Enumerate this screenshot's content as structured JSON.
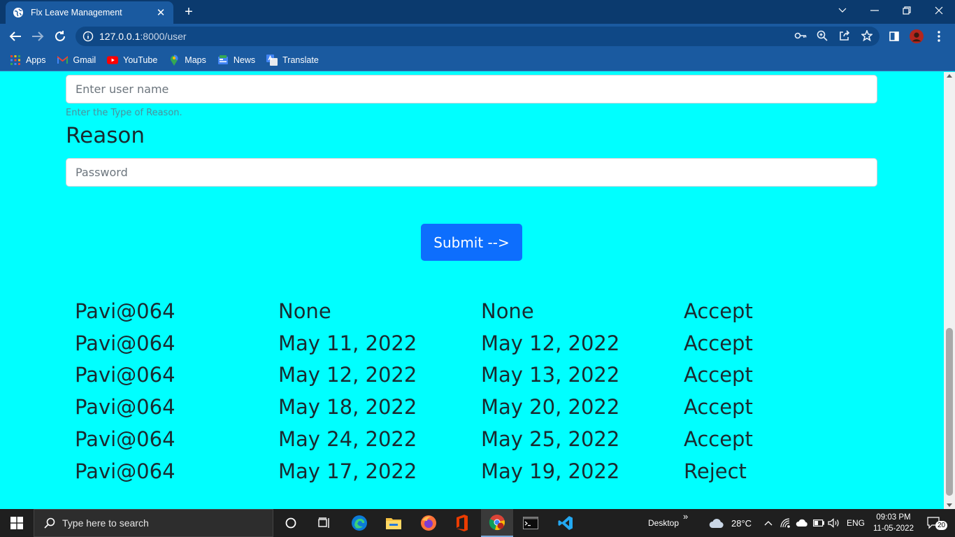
{
  "browser": {
    "tab_title": "Flx Leave Management",
    "tab_close": "✕",
    "new_tab": "+",
    "url_host": "127.0.0.1",
    "url_path": ":8000/user",
    "bookmarks": [
      {
        "label": "Apps",
        "icon": "apps-grid-icon"
      },
      {
        "label": "Gmail",
        "icon": "gmail-icon"
      },
      {
        "label": "YouTube",
        "icon": "youtube-icon"
      },
      {
        "label": "Maps",
        "icon": "maps-icon"
      },
      {
        "label": "News",
        "icon": "news-icon"
      },
      {
        "label": "Translate",
        "icon": "translate-icon"
      }
    ]
  },
  "form": {
    "username_placeholder": "Enter user name",
    "username_help": "Enter the Type of Reason.",
    "reason_heading": "Reason",
    "reason_placeholder": "Password",
    "submit_label": "Submit -->"
  },
  "records": [
    {
      "user": "Pavi@064",
      "from": "None",
      "to": "None",
      "status": "Accept"
    },
    {
      "user": "Pavi@064",
      "from": "May 11, 2022",
      "to": "May 12, 2022",
      "status": "Accept"
    },
    {
      "user": "Pavi@064",
      "from": "May 12, 2022",
      "to": "May 13, 2022",
      "status": "Accept"
    },
    {
      "user": "Pavi@064",
      "from": "May 18, 2022",
      "to": "May 20, 2022",
      "status": "Accept"
    },
    {
      "user": "Pavi@064",
      "from": "May 24, 2022",
      "to": "May 25, 2022",
      "status": "Accept"
    },
    {
      "user": "Pavi@064",
      "from": "May 17, 2022",
      "to": "May 19, 2022",
      "status": "Reject"
    }
  ],
  "taskbar": {
    "search_placeholder": "Type here to search",
    "desktop_label": "Desktop",
    "desktop_chevron": "»",
    "temperature": "28°C",
    "language": "ENG",
    "time": "09:03 PM",
    "date": "11-05-2022",
    "notifications": "20"
  },
  "colors": {
    "page_background": "#00ffff",
    "submit_button": "#0d6efd",
    "browser_frame": "#1a5aa0"
  }
}
